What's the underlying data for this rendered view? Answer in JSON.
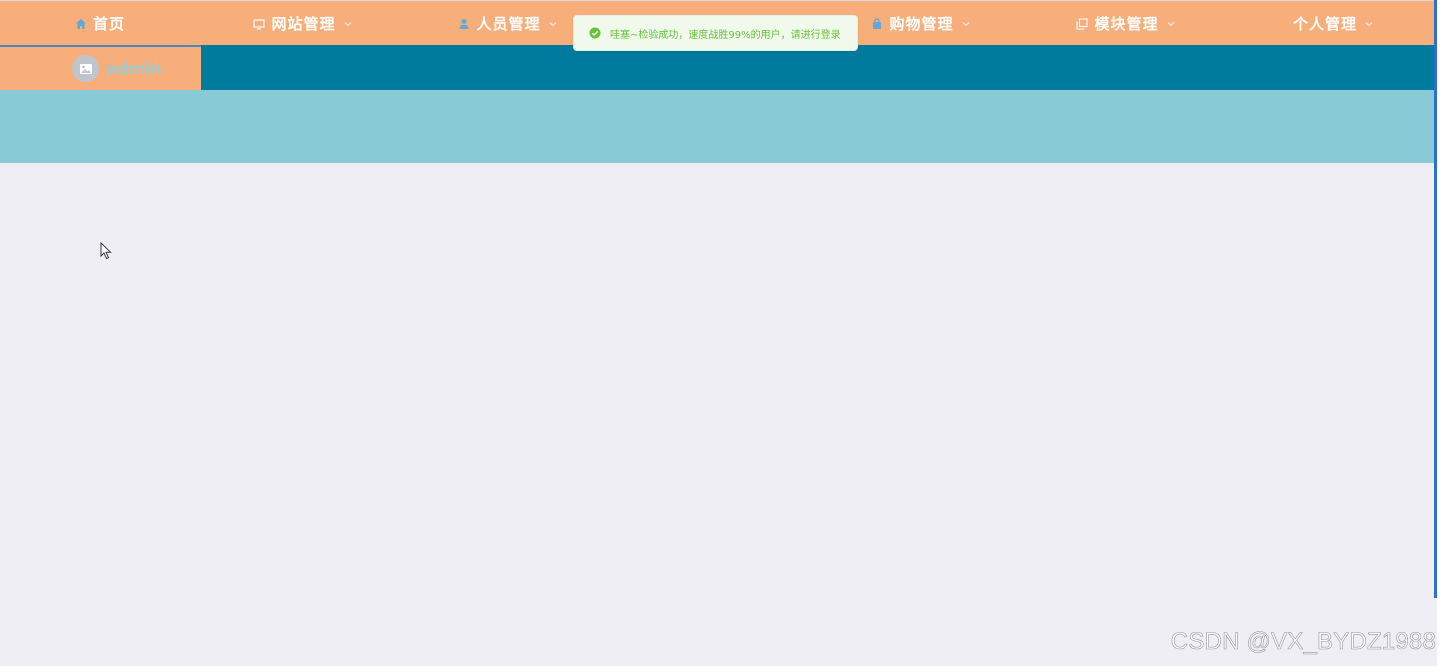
{
  "nav": {
    "items": [
      {
        "label": "首页",
        "icon": "home-icon",
        "has_dropdown": false
      },
      {
        "label": "网站管理",
        "icon": "monitor-icon",
        "has_dropdown": true
      },
      {
        "label": "人员管理",
        "icon": "user-icon",
        "has_dropdown": true
      },
      {
        "label": "购物管理",
        "icon": "shopping-bag-icon",
        "has_dropdown": true
      },
      {
        "label": "模块管理",
        "icon": "copy-icon",
        "has_dropdown": true
      },
      {
        "label": "个人管理",
        "icon": "",
        "has_dropdown": true
      }
    ]
  },
  "user": {
    "name": "admin",
    "avatar_icon": "image-placeholder-icon"
  },
  "toast": {
    "type": "success",
    "message": "哇塞~检验成功，速度战胜99%的用户，请进行登录"
  },
  "watermark": "CSDN @VX_BYDZ1988",
  "colors": {
    "nav_bg": "#f7ae7a",
    "subbar_bg": "#007b9d",
    "banner_bg": "#89cad7",
    "main_bg": "#f0eef5",
    "toast_bg": "#f0f9eb",
    "toast_text": "#67c23a"
  }
}
